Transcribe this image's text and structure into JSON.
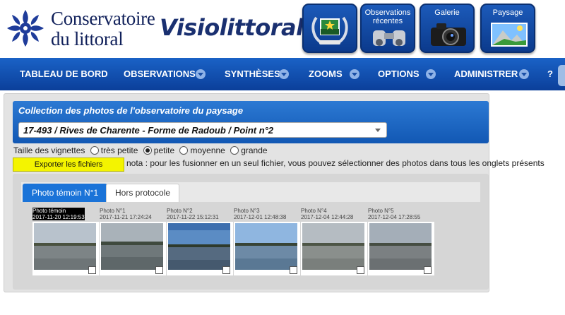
{
  "header": {
    "org_name_line1": "Conservatoire",
    "org_name_line2": "du littoral",
    "app_name": "Visiolittoral",
    "buttons": [
      {
        "label": "",
        "icon": "badge-award-icon"
      },
      {
        "label": "Observations récentes",
        "icon": "binoculars-icon"
      },
      {
        "label": "Galerie",
        "icon": "camera-icon"
      },
      {
        "label": "Paysage",
        "icon": "landscape-icon"
      }
    ]
  },
  "menu": {
    "items": [
      {
        "label": "TABLEAU DE BORD",
        "has_dropdown": false
      },
      {
        "label": "OBSERVATIONS",
        "has_dropdown": true
      },
      {
        "label": "SYNTHÈSES",
        "has_dropdown": true
      },
      {
        "label": "ZOOMS",
        "has_dropdown": true
      },
      {
        "label": "OPTIONS",
        "has_dropdown": true
      },
      {
        "label": "ADMINISTRER",
        "has_dropdown": true
      }
    ],
    "help_label": "?"
  },
  "collection": {
    "title": "Collection des photos de l'observatoire du paysage",
    "selected_point": "17-493 / Rives de Charente - Forme de Radoub / Point n°2"
  },
  "thumb_size": {
    "label": "Taille des vignettes",
    "options": [
      {
        "label": "très petite",
        "checked": false
      },
      {
        "label": "petite",
        "checked": true
      },
      {
        "label": "moyenne",
        "checked": false
      },
      {
        "label": "grande",
        "checked": false
      }
    ]
  },
  "export": {
    "button_label": "Exporter les fichiers sélectionnés",
    "note": "nota : pour les fusionner en un seul fichier, vous pouvez sélectionner des photos dans tous les onglets présents"
  },
  "tabs": [
    {
      "label": "Photo témoin N°1",
      "active": true
    },
    {
      "label": "Hors protocole",
      "active": false
    }
  ],
  "photos": [
    {
      "title": "Photo témoin",
      "date": "2017-11-20 12:19:53",
      "highlighted": true,
      "checked": false
    },
    {
      "title": "Photo N°1",
      "date": "2017-11-21 17:24:24",
      "highlighted": false,
      "checked": false
    },
    {
      "title": "Photo N°2",
      "date": "2017-11-22 15:12:31",
      "highlighted": false,
      "checked": false
    },
    {
      "title": "Photo N°3",
      "date": "2017-12-01 12:48:38",
      "highlighted": false,
      "checked": false
    },
    {
      "title": "Photo N°4",
      "date": "2017-12-04 12:44:28",
      "highlighted": false,
      "checked": false
    },
    {
      "title": "Photo N°5",
      "date": "2017-12-04 17:28:55",
      "highlighted": false,
      "checked": false
    }
  ],
  "colors": {
    "menu_blue": "#1a62c6",
    "tab_active": "#1a73d8",
    "export_yellow": "#f4f400",
    "brand_navy": "#10205a"
  }
}
